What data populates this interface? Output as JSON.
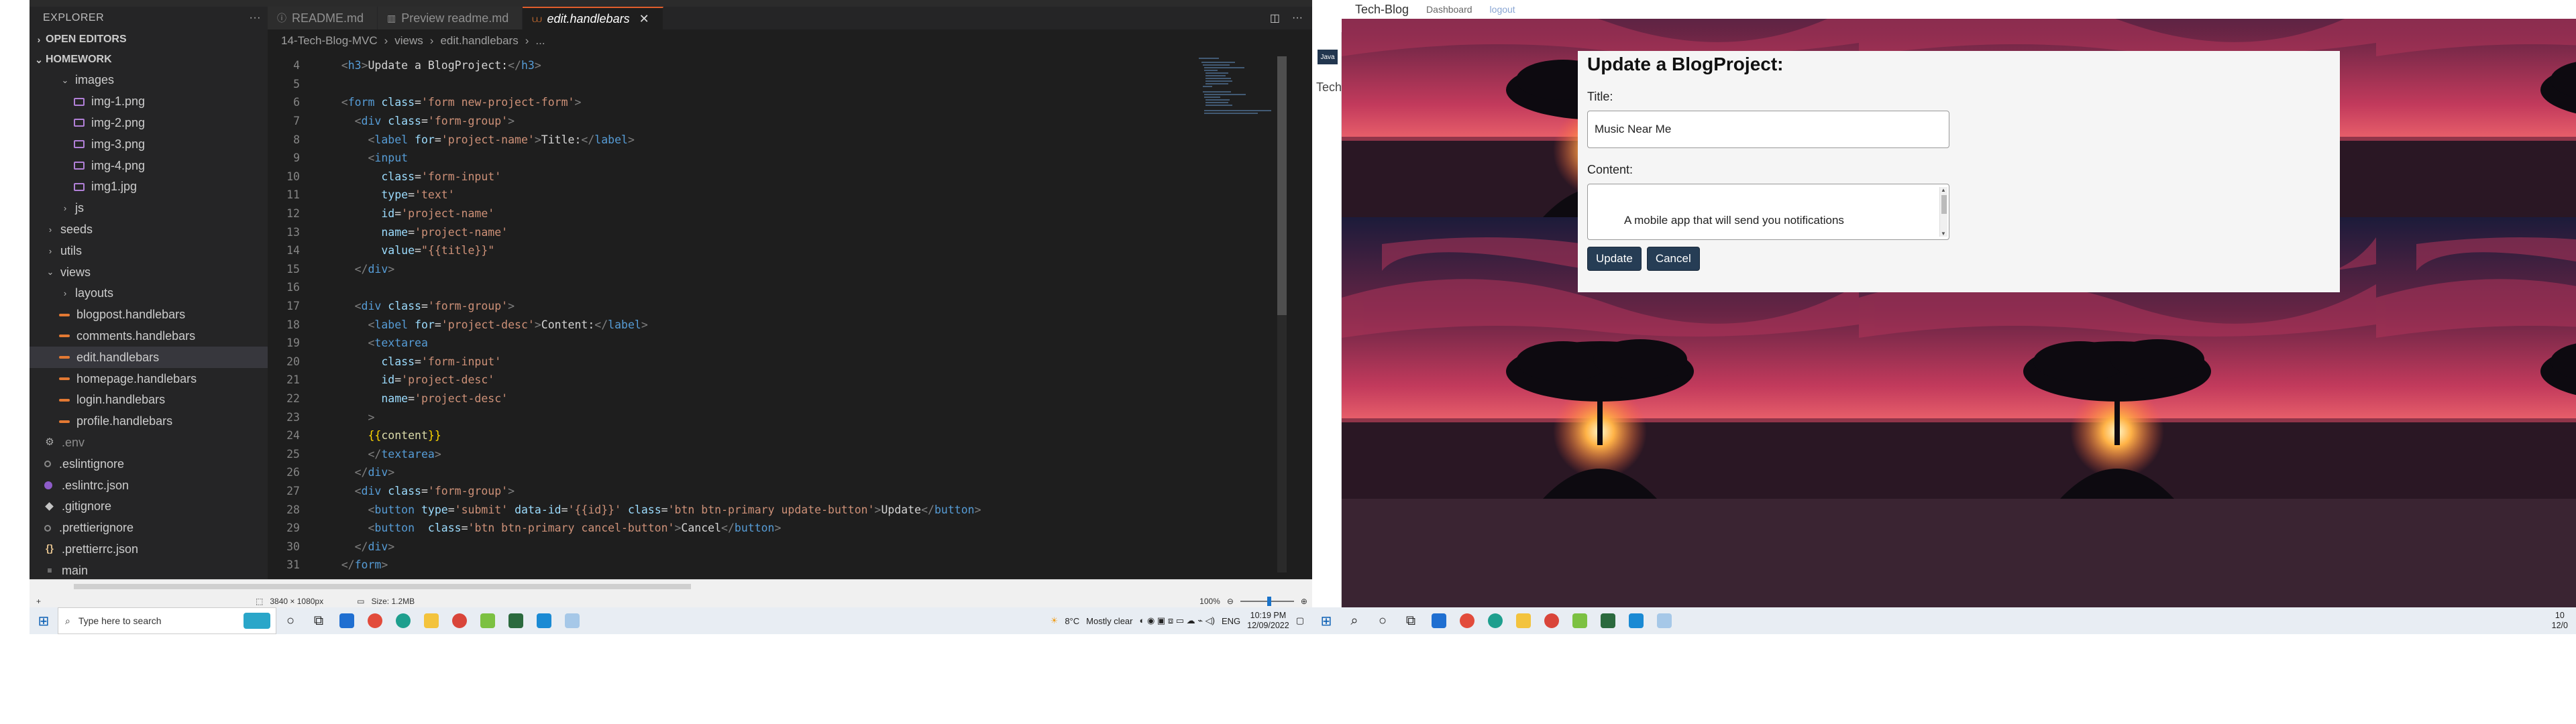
{
  "vscode": {
    "explorer_title": "EXPLORER",
    "open_editors": "OPEN EDITORS",
    "project": "HOMEWORK",
    "tree": [
      {
        "label": "images",
        "icon": "folder-open-chevron-icon",
        "indent": 1,
        "kind": "folder-open"
      },
      {
        "label": "img-1.png",
        "icon": "image-file-icon",
        "indent": 2,
        "kind": "img"
      },
      {
        "label": "img-2.png",
        "icon": "image-file-icon",
        "indent": 2,
        "kind": "img"
      },
      {
        "label": "img-3.png",
        "icon": "image-file-icon",
        "indent": 2,
        "kind": "img"
      },
      {
        "label": "img-4.png",
        "icon": "image-file-icon",
        "indent": 2,
        "kind": "img"
      },
      {
        "label": "img1.jpg",
        "icon": "image-file-icon",
        "indent": 2,
        "kind": "img"
      },
      {
        "label": "js",
        "icon": "folder-closed-chevron-icon",
        "indent": 1,
        "kind": "folder"
      },
      {
        "label": "seeds",
        "icon": "folder-closed-chevron-icon",
        "indent": 0,
        "kind": "folder"
      },
      {
        "label": "utils",
        "icon": "folder-closed-chevron-icon",
        "indent": 0,
        "kind": "folder"
      },
      {
        "label": "views",
        "icon": "folder-open-chevron-icon",
        "indent": 0,
        "kind": "folder-open"
      },
      {
        "label": "layouts",
        "icon": "folder-closed-chevron-icon",
        "indent": 1,
        "kind": "folder"
      },
      {
        "label": "blogpost.handlebars",
        "icon": "handlebars-file-icon",
        "indent": 1,
        "kind": "hbs"
      },
      {
        "label": "comments.handlebars",
        "icon": "handlebars-file-icon",
        "indent": 1,
        "kind": "hbs"
      },
      {
        "label": "edit.handlebars",
        "icon": "handlebars-file-icon",
        "indent": 1,
        "kind": "hbs",
        "active": true
      },
      {
        "label": "homepage.handlebars",
        "icon": "handlebars-file-icon",
        "indent": 1,
        "kind": "hbs"
      },
      {
        "label": "login.handlebars",
        "icon": "handlebars-file-icon",
        "indent": 1,
        "kind": "hbs"
      },
      {
        "label": "profile.handlebars",
        "icon": "handlebars-file-icon",
        "indent": 1,
        "kind": "hbs"
      },
      {
        "label": ".env",
        "icon": "gear-icon",
        "indent": 0,
        "kind": "env",
        "dim": true
      },
      {
        "label": ".eslintignore",
        "icon": "circle-file-icon",
        "indent": 0,
        "kind": "dot"
      },
      {
        "label": ".eslintrc.json",
        "icon": "eslint-icon",
        "indent": 0,
        "kind": "es"
      },
      {
        "label": ".gitignore",
        "icon": "git-diamond-icon",
        "indent": 0,
        "kind": "diamond"
      },
      {
        "label": ".prettierignore",
        "icon": "circle-file-icon",
        "indent": 0,
        "kind": "dot"
      },
      {
        "label": ".prettierrc.json",
        "icon": "json-braces-icon",
        "indent": 0,
        "kind": "brace"
      },
      {
        "label": "main",
        "icon": "folder-icon",
        "indent": 0,
        "kind": "plain"
      }
    ],
    "tabs": [
      {
        "label": "README.md",
        "icon": "info-icon",
        "active": false
      },
      {
        "label": "Preview readme.md",
        "icon": "preview-icon",
        "active": false
      },
      {
        "label": "edit.handlebars",
        "icon": "handlebars-file-icon",
        "active": true
      }
    ],
    "breadcrumb": [
      "14-Tech-Blog-MVC",
      "views",
      "edit.handlebars",
      "..."
    ],
    "code_lines": [
      {
        "n": "4",
        "html": "    <span class='t-pun'>&lt;</span><span class='t-tag'>h3</span><span class='t-pun'>&gt;</span><span class='t-txt'>Update a BlogProject:</span><span class='t-pun'>&lt;/</span><span class='t-tag'>h3</span><span class='t-pun'>&gt;</span>"
      },
      {
        "n": "5",
        "html": ""
      },
      {
        "n": "6",
        "html": "    <span class='t-pun'>&lt;</span><span class='t-tag'>form</span> <span class='t-attr'>class</span><span class='t-txt'>=</span><span class='t-str'>'form new-project-form'</span><span class='t-pun'>&gt;</span>"
      },
      {
        "n": "7",
        "html": "      <span class='t-pun'>&lt;</span><span class='t-tag'>div</span> <span class='t-attr'>class</span><span class='t-txt'>=</span><span class='t-str'>'form-group'</span><span class='t-pun'>&gt;</span>"
      },
      {
        "n": "8",
        "html": "        <span class='t-pun'>&lt;</span><span class='t-tag'>label</span> <span class='t-attr'>for</span><span class='t-txt'>=</span><span class='t-str'>'project-name'</span><span class='t-pun'>&gt;</span><span class='t-txt'>Title:</span><span class='t-pun'>&lt;/</span><span class='t-tag'>label</span><span class='t-pun'>&gt;</span>"
      },
      {
        "n": "9",
        "html": "        <span class='t-pun'>&lt;</span><span class='t-tag'>input</span>"
      },
      {
        "n": "10",
        "html": "          <span class='t-attr'>class</span><span class='t-txt'>=</span><span class='t-str'>'form-input'</span>"
      },
      {
        "n": "11",
        "html": "          <span class='t-attr'>type</span><span class='t-txt'>=</span><span class='t-str'>'text'</span>"
      },
      {
        "n": "12",
        "html": "          <span class='t-attr'>id</span><span class='t-txt'>=</span><span class='t-str'>'project-name'</span>"
      },
      {
        "n": "13",
        "html": "          <span class='t-attr'>name</span><span class='t-txt'>=</span><span class='t-str'>'project-name'</span>"
      },
      {
        "n": "14",
        "html": "          <span class='t-attr'>value</span><span class='t-txt'>=</span><span class='t-str'>\"{{title}}\"</span>"
      },
      {
        "n": "15",
        "html": "      <span class='t-pun'>&lt;/</span><span class='t-tag'>div</span><span class='t-pun'>&gt;</span>"
      },
      {
        "n": "16",
        "html": ""
      },
      {
        "n": "17",
        "html": "      <span class='t-pun'>&lt;</span><span class='t-tag'>div</span> <span class='t-attr'>class</span><span class='t-txt'>=</span><span class='t-str'>'form-group'</span><span class='t-pun'>&gt;</span>"
      },
      {
        "n": "18",
        "html": "        <span class='t-pun'>&lt;</span><span class='t-tag'>label</span> <span class='t-attr'>for</span><span class='t-txt'>=</span><span class='t-str'>'project-desc'</span><span class='t-pun'>&gt;</span><span class='t-txt'>Content:</span><span class='t-pun'>&lt;/</span><span class='t-tag'>label</span><span class='t-pun'>&gt;</span>"
      },
      {
        "n": "19",
        "html": "        <span class='t-pun'>&lt;</span><span class='t-tag'>textarea</span>"
      },
      {
        "n": "20",
        "html": "          <span class='t-attr'>class</span><span class='t-txt'>=</span><span class='t-str'>'form-input'</span>"
      },
      {
        "n": "21",
        "html": "          <span class='t-attr'>id</span><span class='t-txt'>=</span><span class='t-str'>'project-desc'</span>"
      },
      {
        "n": "22",
        "html": "          <span class='t-attr'>name</span><span class='t-txt'>=</span><span class='t-str'>'project-desc'</span>"
      },
      {
        "n": "23",
        "html": "        <span class='t-pun'>&gt;</span>"
      },
      {
        "n": "24",
        "html": "        <span class='t-br'>{{</span><span class='t-hb'>content</span><span class='t-br'>}}</span>"
      },
      {
        "n": "25",
        "html": "        <span class='t-pun'>&lt;/</span><span class='t-tag'>textarea</span><span class='t-pun'>&gt;</span>"
      },
      {
        "n": "26",
        "html": "      <span class='t-pun'>&lt;/</span><span class='t-tag'>div</span><span class='t-pun'>&gt;</span>"
      },
      {
        "n": "27",
        "html": "      <span class='t-pun'>&lt;</span><span class='t-tag'>div</span> <span class='t-attr'>class</span><span class='t-txt'>=</span><span class='t-str'>'form-group'</span><span class='t-pun'>&gt;</span>"
      },
      {
        "n": "28",
        "html": "        <span class='t-pun'>&lt;</span><span class='t-tag'>button</span> <span class='t-attr'>type</span><span class='t-txt'>=</span><span class='t-str'>'submit'</span> <span class='t-attr'>data-id</span><span class='t-txt'>=</span><span class='t-str'>'{{id}}'</span> <span class='t-attr'>class</span><span class='t-txt'>=</span><span class='t-str'>'btn btn-primary update-button'</span><span class='t-pun'>&gt;</span><span class='t-txt'>Update</span><span class='t-pun'>&lt;/</span><span class='t-tag'>button</span><span class='t-pun'>&gt;</span>"
      },
      {
        "n": "29",
        "html": "        <span class='t-pun'>&lt;</span><span class='t-tag'>button</span>  <span class='t-attr'>class</span><span class='t-txt'>=</span><span class='t-str'>'btn btn-primary cancel-button'</span><span class='t-pun'>&gt;</span><span class='t-txt'>Cancel</span><span class='t-pun'>&lt;/</span><span class='t-tag'>button</span><span class='t-pun'>&gt;</span>"
      },
      {
        "n": "30",
        "html": "      <span class='t-pun'>&lt;/</span><span class='t-tag'>div</span><span class='t-pun'>&gt;</span>"
      },
      {
        "n": "31",
        "html": "    <span class='t-pun'>&lt;/</span><span class='t-tag'>form</span><span class='t-pun'>&gt;</span>"
      }
    ]
  },
  "viewer": {
    "dimensions": "3840 × 1080px",
    "size": "Size: 1.2MB",
    "zoom": "100%"
  },
  "browser": {
    "tab_partial": "Tech-",
    "pin_label": "Java",
    "nav_brand": "Tech-Blog",
    "nav_dashboard": "Dashboard",
    "nav_logout": "logout",
    "form": {
      "heading": "Update a BlogProject:",
      "title_label": "Title:",
      "title_value": "Music Near Me",
      "content_label": "Content:",
      "content_value": "A mobile app that will send you notifications",
      "update_btn": "Update",
      "cancel_btn": "Cancel"
    }
  },
  "taskbar_left": {
    "search_placeholder": "Type here to search",
    "weather_temp": "8°C",
    "weather_desc": "Mostly clear",
    "lang": "ENG",
    "time": "10:19 PM",
    "date": "12/09/2022"
  },
  "taskbar_right": {
    "time": "10",
    "date": "12/0"
  },
  "colors": {
    "editor_bg": "#1e1e1e",
    "sidebar_bg": "#252526",
    "tag": "#569cd6",
    "attr": "#9cdcfe",
    "string": "#ce9178",
    "button_bg": "#263d55"
  }
}
